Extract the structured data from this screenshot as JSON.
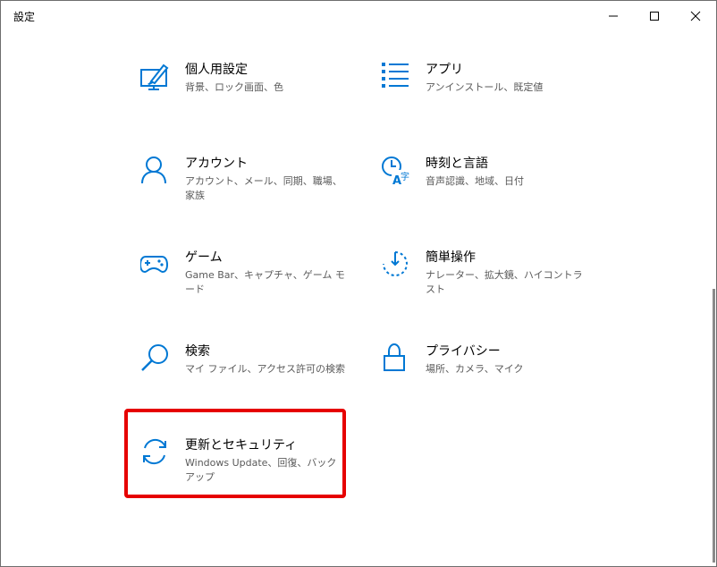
{
  "window": {
    "title": "設定",
    "controls": [
      "minimize",
      "maximize",
      "close"
    ]
  },
  "accent_color": "#0078d4",
  "highlight_color": "#e60000",
  "tiles": [
    {
      "icon": "personalization-icon",
      "label": "個人用設定",
      "desc": "背景、ロック画面、色"
    },
    {
      "icon": "apps-icon",
      "label": "アプリ",
      "desc": "アンインストール、既定値"
    },
    {
      "icon": "accounts-icon",
      "label": "アカウント",
      "desc": "アカウント、メール、同期、職場、家族"
    },
    {
      "icon": "time-language-icon",
      "label": "時刻と言語",
      "desc": "音声認識、地域、日付"
    },
    {
      "icon": "gaming-icon",
      "label": "ゲーム",
      "desc": "Game Bar、キャプチャ、ゲーム モード"
    },
    {
      "icon": "ease-of-access-icon",
      "label": "簡単操作",
      "desc": "ナレーター、拡大鏡、ハイコントラスト"
    },
    {
      "icon": "search-icon",
      "label": "検索",
      "desc": "マイ ファイル、アクセス許可の検索"
    },
    {
      "icon": "privacy-icon",
      "label": "プライバシー",
      "desc": "場所、カメラ、マイク"
    },
    {
      "icon": "update-security-icon",
      "label": "更新とセキュリティ",
      "desc": "Windows Update、回復、バックアップ"
    }
  ]
}
